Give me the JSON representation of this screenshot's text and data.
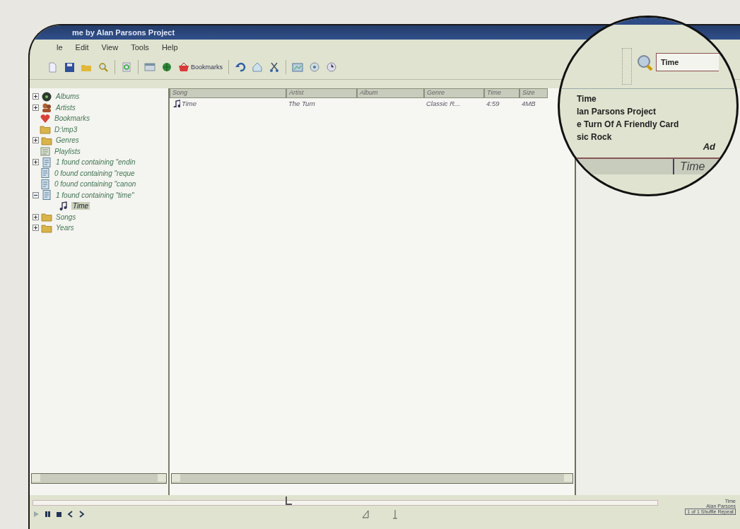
{
  "window": {
    "title": "me by Alan Parsons Project"
  },
  "menu": [
    "le",
    "Edit",
    "View",
    "Tools",
    "Help"
  ],
  "toolbar": {
    "bookmarks_label": "Bookmarks"
  },
  "tree": [
    {
      "label": "Albums",
      "kind": "disc",
      "expanded": false,
      "selected": false
    },
    {
      "label": "Artists",
      "kind": "people",
      "expanded": false,
      "selected": false
    },
    {
      "label": "Bookmarks",
      "kind": "heart",
      "selected": false
    },
    {
      "label": "D:\\mp3",
      "kind": "folder",
      "selected": false
    },
    {
      "label": "Genres",
      "kind": "folder",
      "expanded": false,
      "selected": false
    },
    {
      "label": "Playlists",
      "kind": "playlist",
      "selected": false
    },
    {
      "label": "1 found containing \"endin",
      "kind": "search",
      "expanded": false,
      "selected": false
    },
    {
      "label": "0 found containing \"reque",
      "kind": "search",
      "selected": false
    },
    {
      "label": "0 found containing \"canon",
      "kind": "search",
      "selected": false
    },
    {
      "label": "1 found containing \"time\"",
      "kind": "search",
      "expanded": true,
      "selected": false,
      "children": [
        {
          "label": "Time",
          "kind": "song",
          "selected": true
        }
      ]
    },
    {
      "label": "Songs",
      "kind": "folder",
      "expanded": false,
      "selected": false
    },
    {
      "label": "Years",
      "kind": "folder",
      "expanded": false,
      "selected": false
    }
  ],
  "table": {
    "columns": [
      "Song",
      "Artist",
      "Album",
      "Genre",
      "Time",
      "Size"
    ],
    "rows": [
      {
        "cells": [
          "Time",
          "The Turn",
          "",
          "Classic R...",
          "4:59",
          "4MB"
        ]
      }
    ]
  },
  "lens": {
    "search": {
      "value": "Time"
    },
    "details": [
      "Time",
      "lan Parsons Project",
      "e Turn Of A Friendly Card",
      "sic Rock"
    ],
    "side_label": "Ad",
    "header": "Time"
  },
  "player": {
    "seek": {
      "level": 0.41
    },
    "status": [
      "Time",
      "Alan Parsons",
      "1 of 1 Shuffle Repeat"
    ]
  }
}
